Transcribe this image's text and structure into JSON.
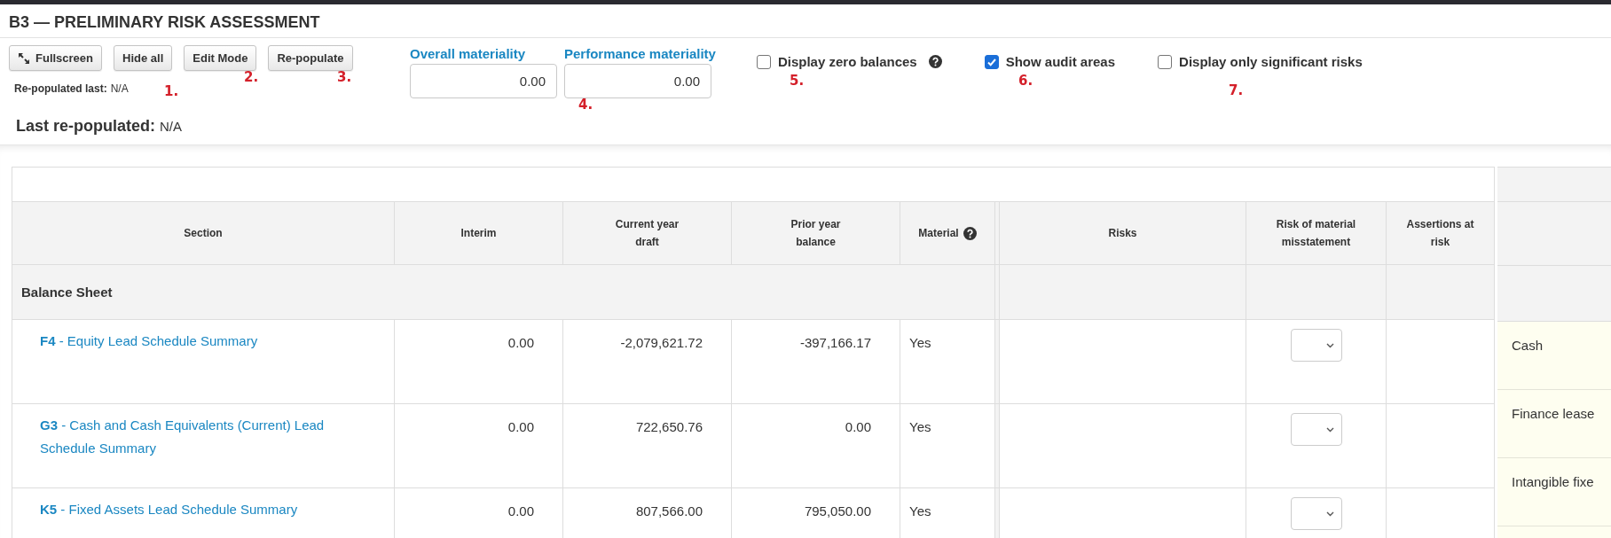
{
  "title": "B3 — PRELIMINARY RISK ASSESSMENT",
  "buttons": [
    {
      "label": "Fullscreen",
      "kind": "icon"
    },
    {
      "label": "Hide all",
      "kind": "plain"
    },
    {
      "label": "Edit Mode",
      "kind": "plain"
    },
    {
      "label": "Re-populate",
      "kind": "plain"
    }
  ],
  "repopulated_last": {
    "label": "Re-populated last:",
    "value": "N/A"
  },
  "materiality": [
    {
      "label": "Overall materiality",
      "value": "0.00"
    },
    {
      "label": "Performance materiality",
      "value": "0.00"
    }
  ],
  "options": [
    {
      "label": "Display zero balances",
      "checked": false,
      "help": true
    },
    {
      "label": "Show audit areas",
      "checked": true
    },
    {
      "label": "Display only significant risks",
      "checked": false
    }
  ],
  "markers": [
    "1.",
    "2.",
    "3.",
    "4.",
    "5.",
    "6.",
    "7."
  ],
  "last_repopulated": {
    "label": "Last re-populated:",
    "value": "N/A"
  },
  "table": {
    "columns": [
      {
        "label": "Section"
      },
      {
        "label": "Interim"
      },
      {
        "label": "Current year draft"
      },
      {
        "label": "Prior year balance"
      },
      {
        "label": "Material",
        "help": true
      },
      {
        "label": "Risks"
      },
      {
        "label": "Risk of material misstatement"
      },
      {
        "label": "Assertions at risk"
      }
    ],
    "sections": [
      {
        "title": "Balance Sheet",
        "rows": [
          {
            "section": "**F4** - Equity Lead Schedule Summary",
            "interim": "0.00",
            "current": "-2,079,621.72",
            "prior": "-397,166.17",
            "material": "Yes"
          },
          {
            "section": "**G3** - Cash and Cash Equivalents (Current) Lead Schedule Summary",
            "interim": "0.00",
            "current": "722,650.76",
            "prior": "0.00",
            "material": "Yes"
          },
          {
            "section": "**K5** - Fixed Assets Lead Schedule Summary",
            "interim": "0.00",
            "current": "807,566.00",
            "prior": "795,050.00",
            "material": "Yes"
          }
        ]
      }
    ],
    "audit_areas": [
      "Cash",
      "Finance lease",
      "Intangible fixe"
    ]
  }
}
